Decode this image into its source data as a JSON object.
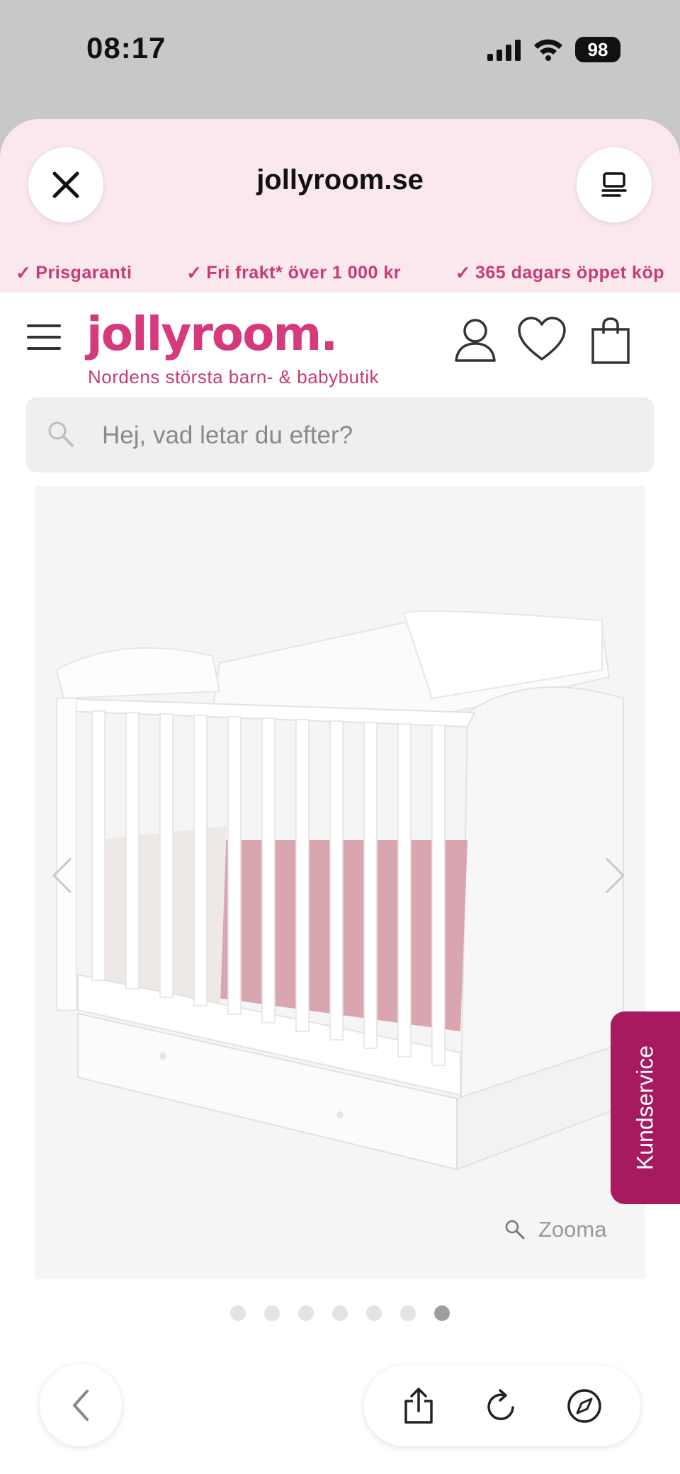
{
  "status_bar": {
    "time": "08:17",
    "battery": "98"
  },
  "browser": {
    "domain": "jollyroom.se"
  },
  "usps": [
    "Prisgaranti",
    "Fri frakt* över 1 000 kr",
    "365 dagars öppet köp"
  ],
  "site": {
    "logo": "jollyroom.",
    "tagline": "Nordens största barn- & babybutik"
  },
  "search": {
    "placeholder": "Hej, vad letar du efter?"
  },
  "gallery": {
    "zoom_label": "Zooma",
    "total_images": 7,
    "active_index": 6
  },
  "support": {
    "label": "Kundservice"
  },
  "colors": {
    "brand": "#d63a7c",
    "support_bg": "#a81a5f",
    "header_bg": "#fbe8ec"
  }
}
